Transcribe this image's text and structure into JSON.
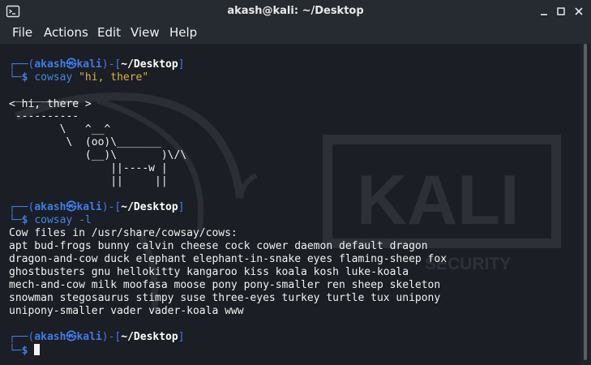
{
  "window": {
    "title": "akash@kali: ~/Desktop",
    "icons": [
      "terminal-app-icon",
      "minimize-icon",
      "maximize-icon",
      "close-icon"
    ]
  },
  "menu": [
    "File",
    "Actions",
    "Edit",
    "View",
    "Help"
  ],
  "prompt": {
    "user": "akash",
    "at": "㉿",
    "host": "kali",
    "path": "~/Desktop"
  },
  "commands": [
    {
      "name": "cowsay",
      "arg": "\"hi, there\""
    },
    {
      "name": "cowsay",
      "arg": "-l"
    }
  ],
  "cow_output": [
    " __________",
    "< hi, there >",
    " ----------",
    "        \\   ^__^",
    "         \\  (oo)\\_______",
    "            (__)\\       )\\/\\",
    "                ||----w |",
    "                ||     ||"
  ],
  "list_output": [
    "Cow files in /usr/share/cowsay/cows:",
    "apt bud-frogs bunny calvin cheese cock cower daemon default dragon",
    "dragon-and-cow duck elephant elephant-in-snake eyes flaming-sheep fox",
    "ghostbusters gnu hellokitty kangaroo kiss koala kosh luke-koala",
    "mech-and-cow milk moofasa moose pony pony-smaller ren sheep skeleton",
    "snowman stegosaurus stimpy suse three-eyes turkey turtle tux unipony",
    "unipony-smaller vader vader-koala www"
  ],
  "watermark": {
    "text": "KALI",
    "subtext": "SECURITY"
  },
  "colors": {
    "prompt_blue": "#3e7de8",
    "prompt_green": "#2fbb57",
    "command_blue": "#3d8ae6",
    "string_yellow": "#d8b347",
    "background": "#1b1e24"
  }
}
